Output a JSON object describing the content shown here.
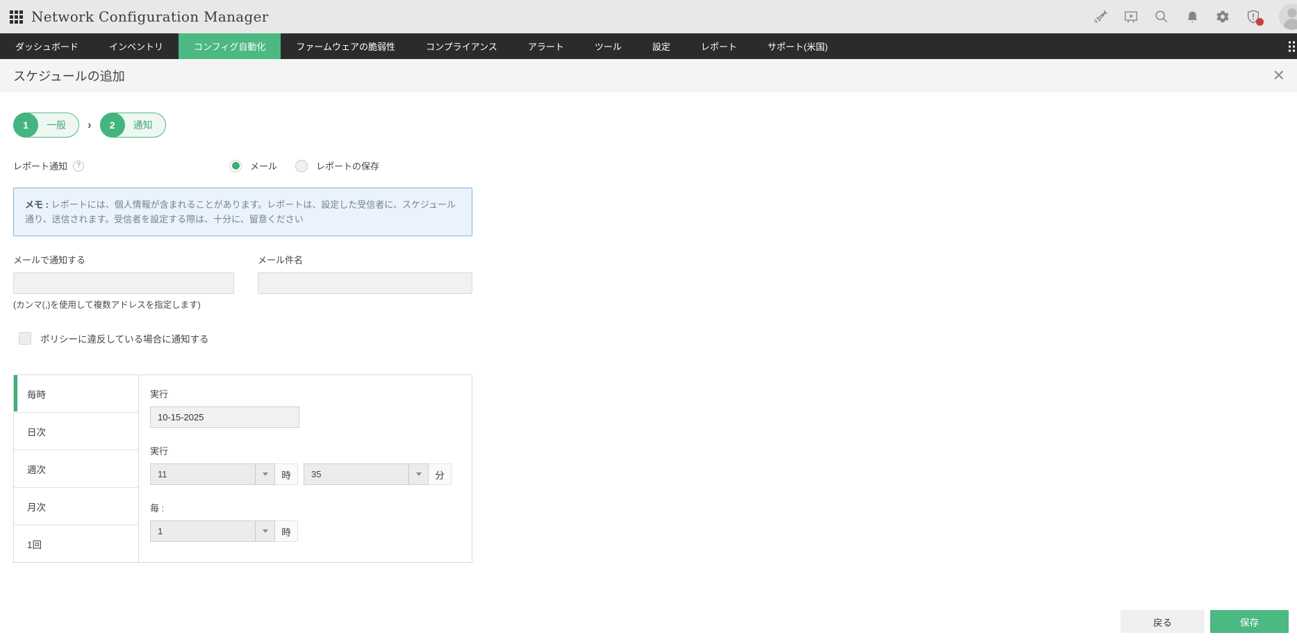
{
  "header": {
    "brand": "Network Configuration Manager",
    "icons": [
      "apps-grid",
      "rocket",
      "presentation",
      "search",
      "notifications-bell",
      "settings-gear",
      "security-alert-shield",
      "user-avatar"
    ]
  },
  "nav": {
    "items": [
      {
        "label": "ダッシュボード",
        "active": false
      },
      {
        "label": "インベントリ",
        "active": false
      },
      {
        "label": "コンフィグ自動化",
        "active": true
      },
      {
        "label": "ファームウェアの脆弱性",
        "active": false
      },
      {
        "label": "コンプライアンス",
        "active": false
      },
      {
        "label": "アラート",
        "active": false
      },
      {
        "label": "ツール",
        "active": false
      },
      {
        "label": "設定",
        "active": false
      },
      {
        "label": "レポート",
        "active": false
      },
      {
        "label": "サポート(米国)",
        "active": false
      }
    ]
  },
  "page": {
    "title": "スケジュールの追加"
  },
  "steps": [
    {
      "number": "1",
      "label": "一般"
    },
    {
      "number": "2",
      "label": "通知"
    }
  ],
  "notify": {
    "label": "レポート通知",
    "help": "?",
    "options": [
      {
        "label": "メール",
        "selected": true
      },
      {
        "label": "レポートの保存",
        "selected": false
      }
    ]
  },
  "memo": {
    "prefix": "メモ :",
    "text": " レポートには、個人情報が含まれることがあります。レポートは、設定した受信者に、スケジュール通り、送信されます。受信者を設定する際は、十分に、留意ください"
  },
  "fields": {
    "email_label": "メールで通知する",
    "email_value": "",
    "email_hint": "(カンマ(,)を使用して複数アドレスを指定します)",
    "subject_label": "メール件名",
    "subject_value": ""
  },
  "policy_checkbox": {
    "label": "ポリシーに違反している場合に通知する",
    "checked": false
  },
  "schedule": {
    "tabs": [
      {
        "label": "毎時",
        "active": true
      },
      {
        "label": "日次",
        "active": false
      },
      {
        "label": "週次",
        "active": false
      },
      {
        "label": "月次",
        "active": false
      },
      {
        "label": "1回",
        "active": false
      }
    ],
    "panel": {
      "run_date_label": "実行",
      "run_date_value": "10-15-2025",
      "run_time_label": "実行",
      "hour_value": "11",
      "hour_suffix": "時",
      "minute_value": "35",
      "minute_suffix": "分",
      "every_label": "毎 :",
      "every_value": "1",
      "every_suffix": "時"
    }
  },
  "footer": {
    "back_label": "戻る",
    "save_label": "保存"
  },
  "colors": {
    "accent_green": "#4cb882",
    "nav_bg": "#2b2b2b",
    "memo_bg": "#eaf3fb",
    "memo_border": "#84b3d8",
    "alert_red": "#ce3b3b"
  }
}
